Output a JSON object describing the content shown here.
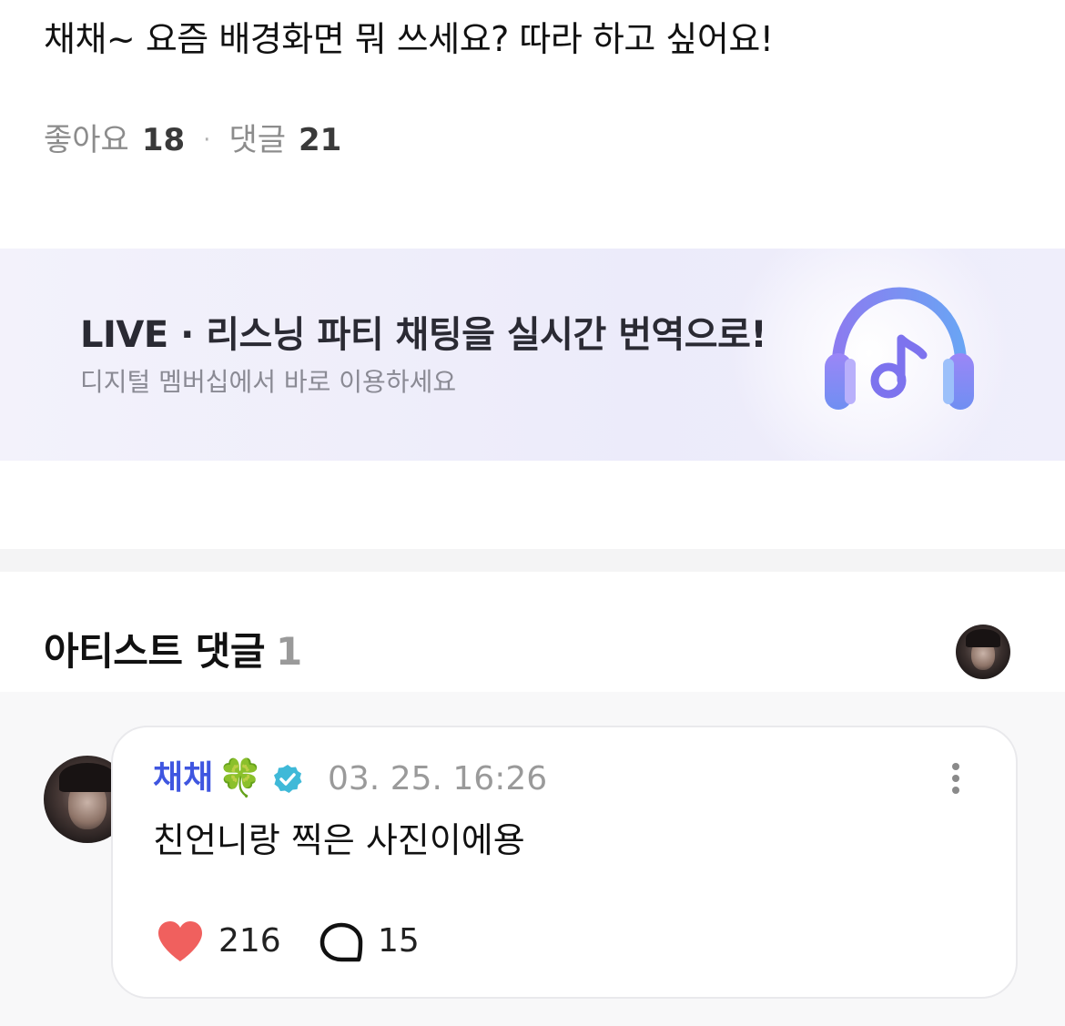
{
  "post": {
    "text": "채채~ 요즘 배경화면 뭐 쓰세요? 따라 하고 싶어요!",
    "likes_label": "좋아요",
    "likes_count": "18",
    "separator": "·",
    "comments_label": "댓글",
    "comments_count": "21"
  },
  "banner": {
    "title": "LIVE · 리스닝 파티 채팅을 실시간 번역으로!",
    "subtitle": "디지털 멤버십에서 바로 이용하세요",
    "icon": "headphones-music-icon"
  },
  "artist_comments": {
    "title": "아티스트 댓글",
    "count": "1"
  },
  "comment": {
    "author": "채채",
    "author_emoji": "🍀",
    "verified_icon": "verified-badge-icon",
    "time": "03. 25. 16:26",
    "text": "친언니랑 찍은 사진이에용",
    "like_count": "216",
    "reply_count": "15"
  },
  "colors": {
    "accent_name": "#3f56e0",
    "verified": "#3fb9d8",
    "heart": "#f0605e",
    "banner_bg": "#ecebfa"
  }
}
